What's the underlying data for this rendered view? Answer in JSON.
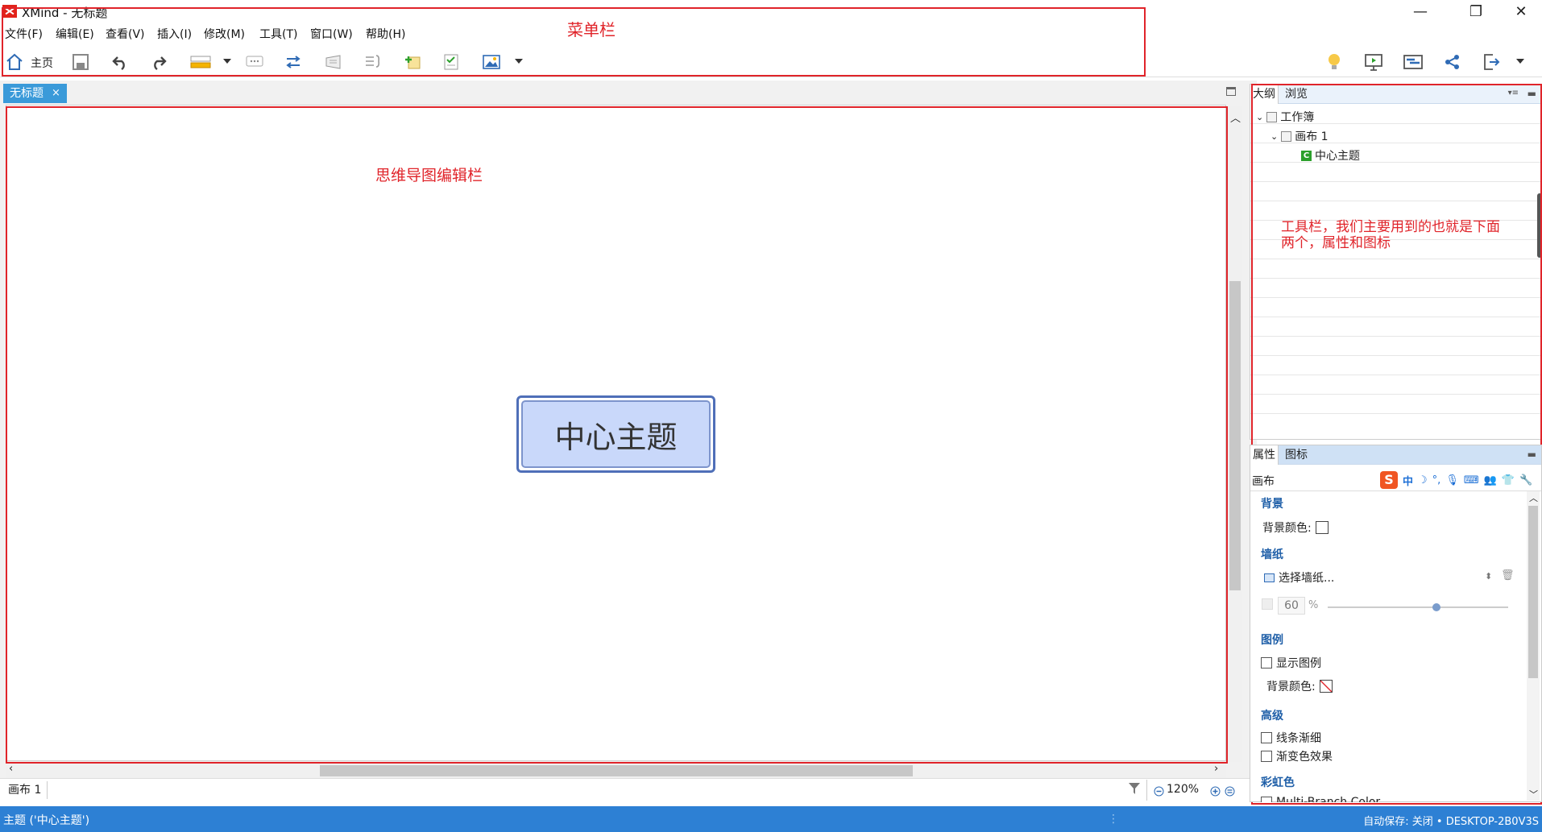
{
  "window": {
    "title": "XMind - 无标题",
    "minimize": "—",
    "restore": "❐",
    "close": "✕"
  },
  "menu": [
    "文件(F)",
    "编辑(E)",
    "查看(V)",
    "插入(I)",
    "修改(M)",
    "工具(T)",
    "窗口(W)",
    "帮助(H)"
  ],
  "toolbar": {
    "home_label": "主页",
    "icons": [
      "home-icon",
      "save-icon",
      "undo-icon",
      "redo-icon",
      "topic-icon",
      "callout-icon",
      "relationship-icon",
      "boundary-icon",
      "summary-icon",
      "note-icon",
      "task-icon",
      "image-icon",
      "idea-icon",
      "presentation-icon",
      "gantt-icon",
      "share-icon",
      "export-icon"
    ]
  },
  "editor": {
    "tab_title": "无标题",
    "tab_close": "×",
    "central_topic": "中心主题",
    "sheet_tab": "画布 1",
    "zoom": "120%"
  },
  "annotations": {
    "menubar": "菜单栏",
    "editor": "思维导图编辑栏",
    "tools_line1": "工具栏，我们主要用到的也就是下面",
    "tools_line2": "两个，属性和图标"
  },
  "outline": {
    "tabs": [
      "大纲",
      "浏览"
    ],
    "tree": [
      "工作簿",
      "画布 1",
      "中心主题"
    ]
  },
  "properties": {
    "tabs": [
      "属性",
      "图标"
    ],
    "context": "画布",
    "background_title": "背景",
    "background_color_label": "背景颜色:",
    "wallpaper_title": "墙纸",
    "wallpaper_button": "选择墙纸...",
    "opacity_value": "60",
    "opacity_unit": "%",
    "legend_title": "图例",
    "show_legend": "显示图例",
    "legend_bg_label": "背景颜色:",
    "advanced_title": "高级",
    "taper_lines": "线条渐细",
    "gradient_effect": "渐变色效果",
    "rainbow_title": "彩虹色",
    "multi_branch": "Multi-Branch Color",
    "ime_mode": "中"
  },
  "status": {
    "left": "主题 ('中心主题')",
    "right": "自动保存: 关闭 • DESKTOP-2B0V3S"
  }
}
